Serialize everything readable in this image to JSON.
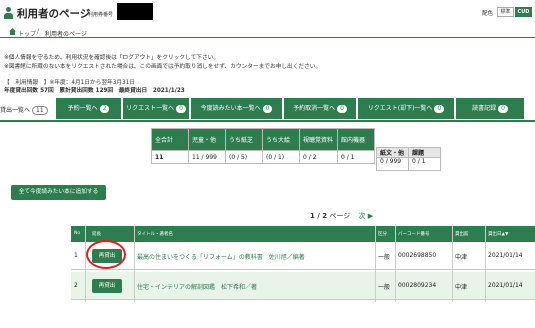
{
  "header": {
    "title": "利用者のページ",
    "card_label": "利用券番号",
    "color_label": "配色",
    "color_std": "標準",
    "color_cud": "CUD"
  },
  "breadcrumb": {
    "home": "トップ",
    "sep": "/",
    "current": "利用者のページ"
  },
  "notices": [
    "※個人情報を守るため、利用状況を確認後は「ログアウト」をクリックして下さい。",
    "※図書館に所蔵のない本をリクエストされた場合は、この画面では予約取り消しをせず、カウンターまでお申し出ください。"
  ],
  "info": {
    "line1": "【　利用情報　】※年度：4月1日から翌年3月31日",
    "line2": "年度貸出回数 57回　累計貸出回数 129回　最終貸出日　2021/1/23"
  },
  "tabs": {
    "first_label": "貸出一覧へ",
    "first_count": "11",
    "items": [
      {
        "label": "予約一覧へ",
        "count": "2"
      },
      {
        "label": "リクエスト一覧へ",
        "count": "0"
      },
      {
        "label": "今度読みたい本一覧へ",
        "count": "0"
      },
      {
        "label": "予約取消一覧へ",
        "count": "0"
      },
      {
        "label": "リクエスト(却下)一覧へ",
        "count": "0"
      },
      {
        "label": "読書記録",
        "count": "0"
      }
    ]
  },
  "summary": {
    "headers": [
      "全合計",
      "児童・他",
      "うち紙芝",
      "うち大絵",
      "視聴覚資料",
      "館内機器"
    ],
    "values": [
      "11",
      "11 / 999",
      "(0 / 5)",
      "(0 / 1)",
      "0 / 2",
      "0 / 1"
    ],
    "headers2": [
      "紙文・他",
      "課題"
    ],
    "values2": [
      "0 / 999",
      "0 / 1"
    ]
  },
  "add_button": "全て今度読みたい本に追加する",
  "pager": {
    "current": "1 / 2",
    "unit": "ページ",
    "next": "次 ▶"
  },
  "list": {
    "columns": [
      "No",
      "延長",
      "タイトル・著者名",
      "区分",
      "バーコード番号",
      "貸出館",
      "貸出日▲▼"
    ],
    "rows": [
      {
        "no": "1",
        "button": "再貸出",
        "title": "最高の住まいをつくる「リフォーム」の教科書　佐川旭／編著",
        "kubun": "一般",
        "barcode": "0002698850",
        "library": "中津",
        "date": "2021/01/14"
      },
      {
        "no": "2",
        "button": "再貸出",
        "title": "住宅・インテリアの解剖図鑑　松下希和／著",
        "kubun": "一般",
        "barcode": "0002809234",
        "library": "中津",
        "date": "2021/01/14"
      }
    ]
  },
  "colors": {
    "accent": "#2e7d4f",
    "highlight": "#e02020"
  }
}
